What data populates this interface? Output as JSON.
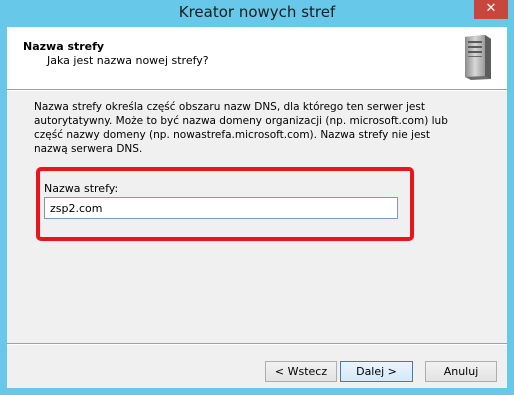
{
  "window": {
    "title": "Kreator nowych stref",
    "close_symbol": "✕"
  },
  "header": {
    "title": "Nazwa strefy",
    "subtitle": "Jaka jest nazwa nowej strefy?",
    "icon": "server-tower-icon"
  },
  "body": {
    "description": "Nazwa strefy określa część obszaru nazw DNS, dla którego ten serwer jest autorytatywny. Może to być nazwa domeny organizacji (np. microsoft.com) lub część nazwy domeny (np. nowastrefa.microsoft.com). Nazwa strefy nie jest nazwą serwera DNS.",
    "zone_label": "Nazwa strefy:",
    "zone_value": "zsp2.com",
    "highlight_color": "#e8161c"
  },
  "footer": {
    "back_label": "< Wstecz",
    "next_label": "Dalej >",
    "cancel_label": "Anuluj"
  }
}
